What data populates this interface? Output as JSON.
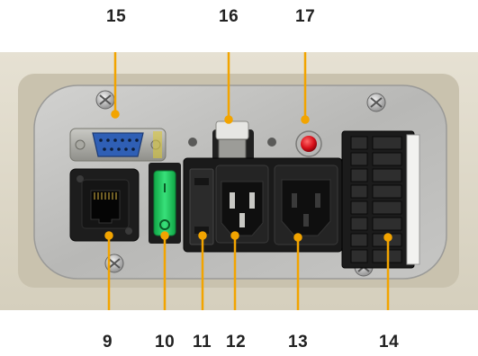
{
  "colors": {
    "callout_line": "#f2a400",
    "label_text": "#222222",
    "cabinet_beige": "#ddd7c6",
    "plate_aluminum": "#bdbdbc",
    "switch_green": "#1ec85a",
    "indicator_red": "#d8101a",
    "db9_blue": "#2f5fb5"
  },
  "callouts": [
    {
      "id": "c9",
      "label": "9",
      "part": "rj45-ethernet-port"
    },
    {
      "id": "c10",
      "label": "10",
      "part": "green-rocker-power-switch"
    },
    {
      "id": "c11",
      "label": "11",
      "part": "fuse-drawer"
    },
    {
      "id": "c12",
      "label": "12",
      "part": "iec-power-inlet"
    },
    {
      "id": "c13",
      "label": "13",
      "part": "iec-power-outlet"
    },
    {
      "id": "c14",
      "label": "14",
      "part": "terminal-block-connector"
    },
    {
      "id": "c15",
      "label": "15",
      "part": "db9-serial-port"
    },
    {
      "id": "c16",
      "label": "16",
      "part": "usb-port"
    },
    {
      "id": "c17",
      "label": "17",
      "part": "red-indicator-lamp"
    }
  ]
}
